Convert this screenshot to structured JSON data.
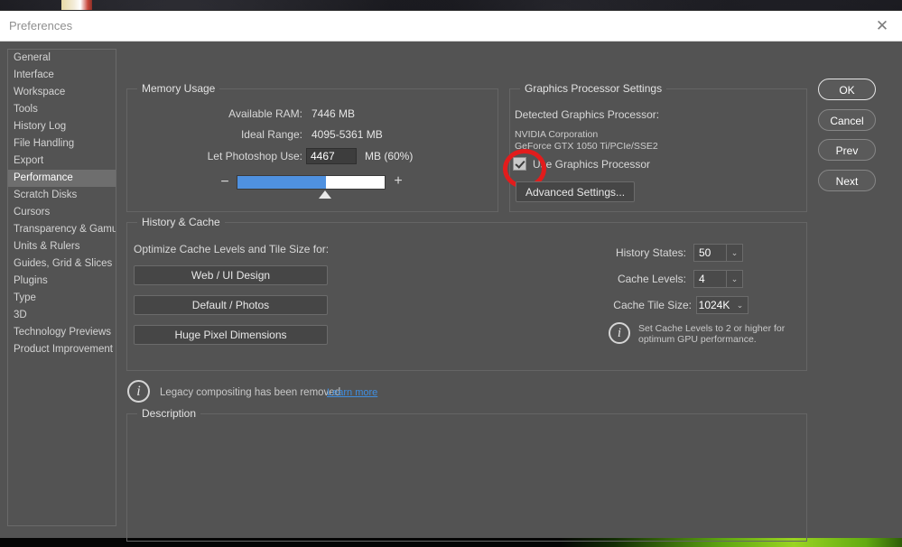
{
  "window": {
    "title": "Preferences",
    "close_icon": "✕"
  },
  "sidebar": {
    "items": [
      {
        "label": "General",
        "selected": false
      },
      {
        "label": "Interface",
        "selected": false
      },
      {
        "label": "Workspace",
        "selected": false
      },
      {
        "label": "Tools",
        "selected": false
      },
      {
        "label": "History Log",
        "selected": false
      },
      {
        "label": "File Handling",
        "selected": false
      },
      {
        "label": "Export",
        "selected": false
      },
      {
        "label": "Performance",
        "selected": true
      },
      {
        "label": "Scratch Disks",
        "selected": false
      },
      {
        "label": "Cursors",
        "selected": false
      },
      {
        "label": "Transparency & Gamut",
        "selected": false
      },
      {
        "label": "Units & Rulers",
        "selected": false
      },
      {
        "label": "Guides, Grid & Slices",
        "selected": false
      },
      {
        "label": "Plugins",
        "selected": false
      },
      {
        "label": "Type",
        "selected": false
      },
      {
        "label": "3D",
        "selected": false
      },
      {
        "label": "Technology Previews",
        "selected": false
      },
      {
        "label": "Product Improvement",
        "selected": false
      }
    ]
  },
  "memory_usage": {
    "group_label": "Memory Usage",
    "available_ram_label": "Available RAM:",
    "available_ram_value": "7446 MB",
    "ideal_range_label": "Ideal Range:",
    "ideal_range_value": "4095-5361 MB",
    "let_photoshop_use_label": "Let Photoshop Use:",
    "let_photoshop_use_value": "4467",
    "unit_percent": "MB (60%)",
    "slider_percent": 60,
    "minus_icon": "−",
    "plus_icon": "+"
  },
  "graphics": {
    "group_label": "Graphics Processor Settings",
    "detected_label": "Detected Graphics Processor:",
    "vendor": "NVIDIA Corporation",
    "model": "GeForce GTX 1050 Ti/PCIe/SSE2",
    "use_gpu_label": "Use Graphics Processor",
    "use_gpu_checked": true,
    "advanced_button": "Advanced Settings...",
    "annotation_color": "#e21c1c"
  },
  "history_cache": {
    "group_label": "History & Cache",
    "optimize_label": "Optimize Cache Levels and Tile Size for:",
    "preset_buttons": [
      "Web / UI Design",
      "Default / Photos",
      "Huge Pixel Dimensions"
    ],
    "history_states_label": "History States:",
    "history_states_value": "50",
    "cache_levels_label": "Cache Levels:",
    "cache_levels_value": "4",
    "cache_tile_size_label": "Cache Tile Size:",
    "cache_tile_size_value": "1024K",
    "info_icon": "i",
    "info_line1": "Set Cache Levels to 2 or higher for",
    "info_line2": "optimum GPU performance.",
    "dropdown_arrow": "⌄"
  },
  "legacy_notice": {
    "icon": "i",
    "text": "Legacy compositing has been removed",
    "link": "Learn more"
  },
  "description": {
    "group_label": "Description",
    "content": ""
  },
  "actions": {
    "buttons": [
      {
        "label": "OK",
        "primary": true
      },
      {
        "label": "Cancel",
        "primary": false
      },
      {
        "label": "Prev",
        "primary": false
      },
      {
        "label": "Next",
        "primary": false
      }
    ]
  }
}
